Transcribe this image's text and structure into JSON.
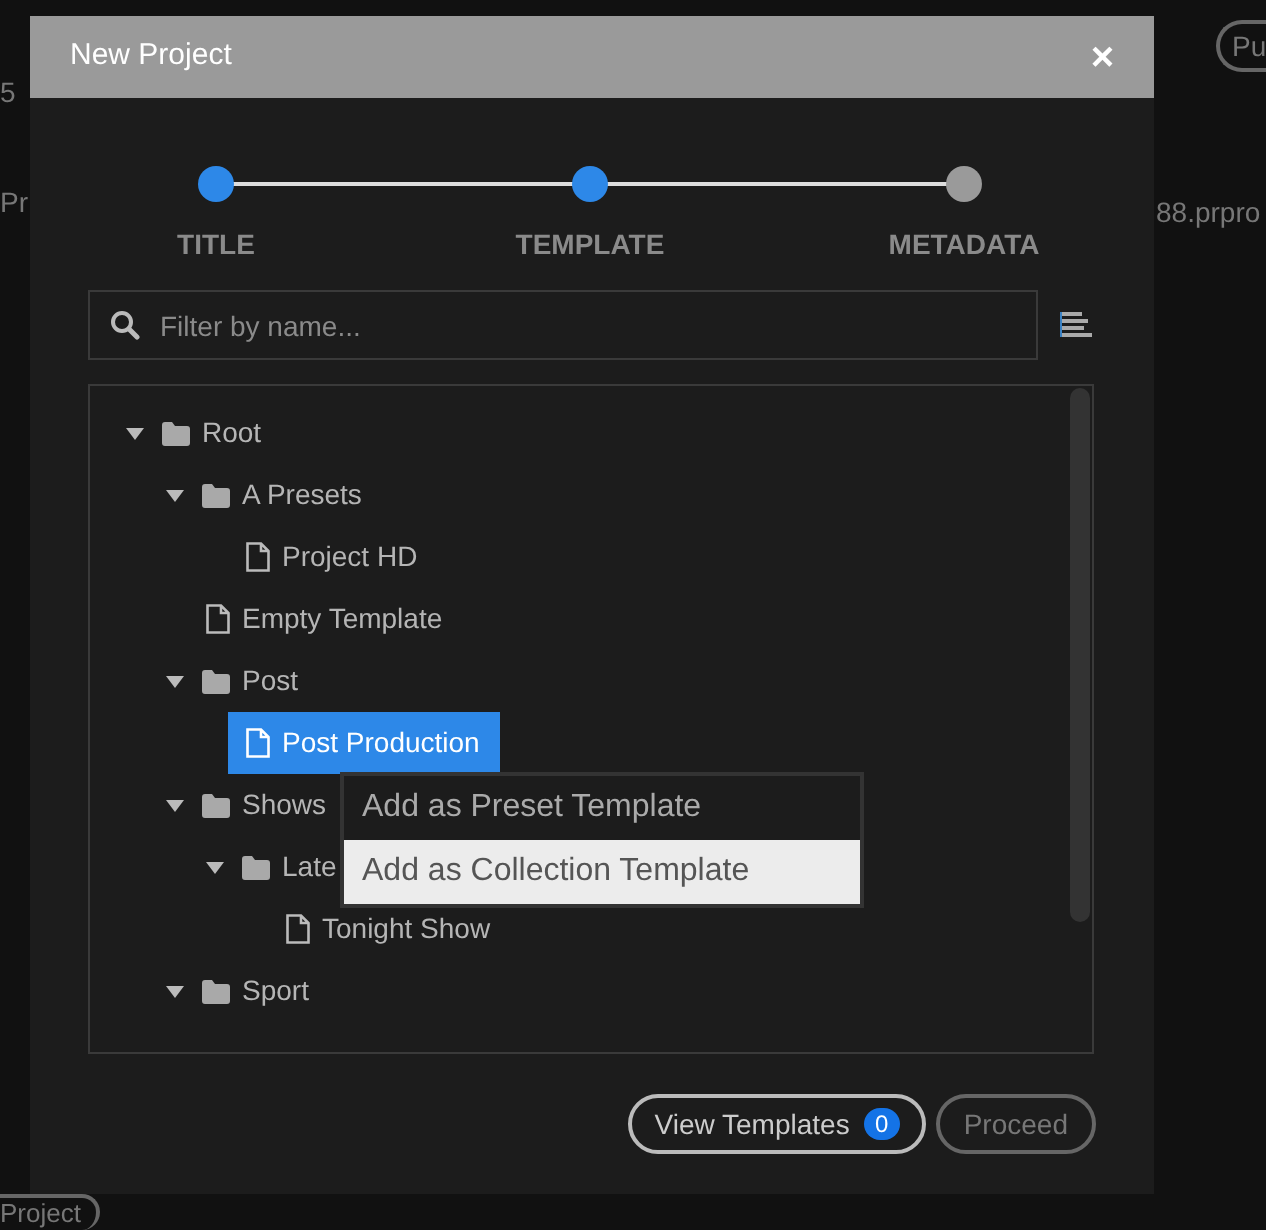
{
  "background": {
    "texts": [
      "5",
      "Pr",
      "88.prpro"
    ],
    "top_pill": "Pu",
    "bottom_pill": "Project"
  },
  "dialog": {
    "title": "New Project",
    "close": "×"
  },
  "steps": [
    {
      "label": "TITLE",
      "completed": true
    },
    {
      "label": "TEMPLATE",
      "completed": true
    },
    {
      "label": "METADATA",
      "completed": false
    }
  ],
  "filter": {
    "placeholder": "Filter by name..."
  },
  "tree": [
    {
      "label": "Root",
      "kind": "folder",
      "expanded": true,
      "selected": false,
      "children": [
        {
          "label": "A Presets",
          "kind": "folder",
          "expanded": true,
          "selected": false,
          "children": [
            {
              "label": "Project HD",
              "kind": "file",
              "selected": false
            }
          ]
        },
        {
          "label": "Empty Template",
          "kind": "file",
          "selected": false
        },
        {
          "label": "Post",
          "kind": "folder",
          "expanded": true,
          "selected": false,
          "children": [
            {
              "label": "Post Production",
              "kind": "file",
              "selected": true
            }
          ]
        },
        {
          "label": "Shows",
          "kind": "folder",
          "expanded": true,
          "selected": false,
          "children": [
            {
              "label": "Late",
              "kind": "folder",
              "expanded": true,
              "selected": false,
              "children": [
                {
                  "label": "Tonight Show",
                  "kind": "file",
                  "selected": false
                }
              ]
            }
          ]
        },
        {
          "label": "Sport",
          "kind": "folder",
          "expanded": true,
          "selected": false
        }
      ]
    }
  ],
  "context_menu": [
    {
      "label": "Add as Preset Template",
      "selected": false
    },
    {
      "label": "Add as Collection Template",
      "selected": true
    }
  ],
  "buttons": {
    "view_templates": {
      "label": "View Templates",
      "badge": "0"
    },
    "proceed": {
      "label": "Proceed",
      "disabled": true
    }
  }
}
